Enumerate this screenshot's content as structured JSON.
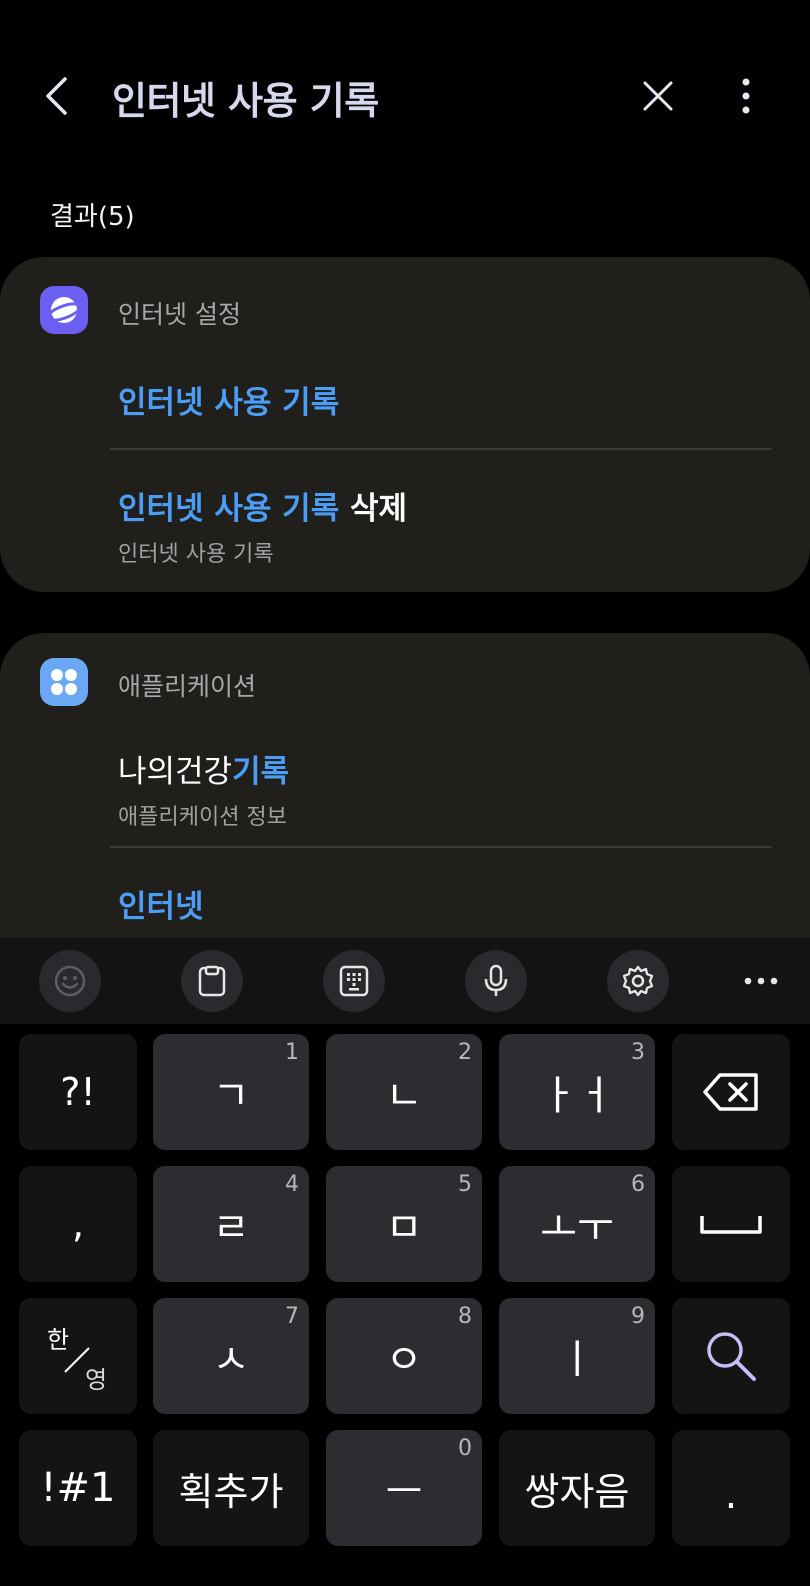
{
  "header": {
    "title": "인터넷 사용 기록",
    "back_icon": "chevron-left-icon",
    "close_icon": "close-icon",
    "more_icon": "more-vertical-icon"
  },
  "results_label": "결과(5)",
  "sections": [
    {
      "category": "인터넷 설정",
      "icon": "samsung-internet-icon",
      "icon_color": "#6b5ff2",
      "items": [
        {
          "highlight": "인터넷 사용 기록",
          "rest": "",
          "sub": ""
        },
        {
          "highlight": "인터넷 사용 기록",
          "rest": " 삭제",
          "sub": "인터넷 사용 기록"
        }
      ]
    },
    {
      "category": "애플리케이션",
      "icon": "apps-icon",
      "icon_color": "#6aa8f5",
      "items": [
        {
          "prefix": "나의건강",
          "highlight": "기록",
          "sub": "애플리케이션 정보"
        },
        {
          "highlight": "인터넷",
          "rest": "",
          "sub": ""
        }
      ]
    }
  ],
  "toolbar": {
    "buttons": [
      "emoji-icon",
      "clipboard-icon",
      "keypad-icon",
      "mic-icon",
      "settings-icon",
      "more-horizontal-icon"
    ]
  },
  "keyboard": {
    "row1": [
      {
        "label": "?!",
        "num": ""
      },
      {
        "label": "ㄱ",
        "num": "1"
      },
      {
        "label": "ㄴ",
        "num": "2"
      },
      {
        "label": "ㅏㅓ",
        "num": "3"
      },
      {
        "label": "backspace-icon",
        "num": ""
      }
    ],
    "row2": [
      {
        "label": ",",
        "num": ""
      },
      {
        "label": "ㄹ",
        "num": "4"
      },
      {
        "label": "ㅁ",
        "num": "5"
      },
      {
        "label": "ㅗㅜ",
        "num": "6"
      },
      {
        "label": "space-icon",
        "num": ""
      }
    ],
    "row3": [
      {
        "label_top": "한",
        "label_bottom": "영",
        "num": ""
      },
      {
        "label": "ㅅ",
        "num": "7"
      },
      {
        "label": "ㅇ",
        "num": "8"
      },
      {
        "label": "ㅣ",
        "num": "9"
      },
      {
        "label": "search-icon",
        "num": ""
      }
    ],
    "row4": [
      {
        "label": "!#1",
        "num": ""
      },
      {
        "label": "획추가",
        "num": ""
      },
      {
        "label": "ㅡ",
        "num": "0"
      },
      {
        "label": "쌍자음",
        "num": ""
      },
      {
        "label": ".",
        "num": ""
      }
    ]
  }
}
